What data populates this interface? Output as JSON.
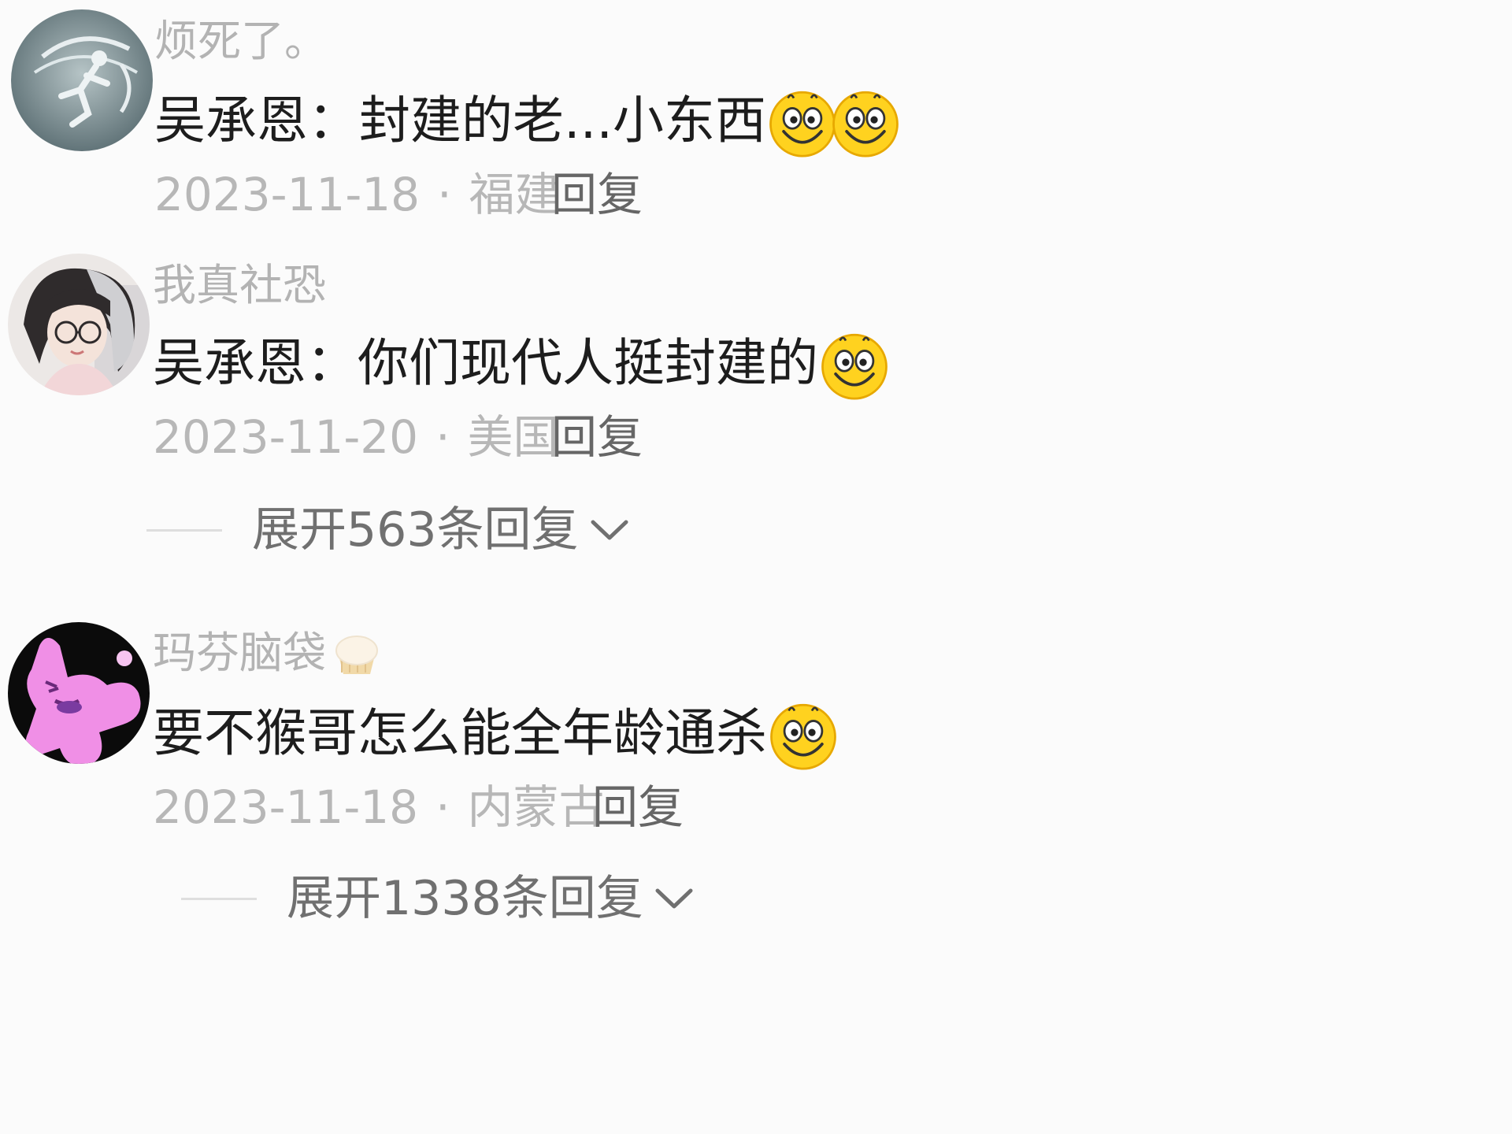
{
  "comments": [
    {
      "username": "烦死了。",
      "content": "吴承恩：封建的老...小东西",
      "emoji_count": 2,
      "date": "2023-11-18",
      "location": "福建",
      "reply_label": "回复"
    },
    {
      "username": "我真社恐",
      "content": "吴承恩：你们现代人挺封建的",
      "emoji_count": 1,
      "date": "2023-11-20",
      "location": "美国",
      "reply_label": "回复",
      "expand_label": "展开563条回复"
    },
    {
      "username": "玛芬脑袋",
      "username_badge_icon": "muffin-icon",
      "content": "要不猴哥怎么能全年龄通杀",
      "emoji_count": 1,
      "date": "2023-11-18",
      "location": "内蒙古",
      "reply_label": "回复",
      "expand_label": "展开1338条回复"
    }
  ],
  "separator": "·",
  "icons": {
    "emoji": "smiling-face-icon",
    "expand": "chevron-down-icon"
  },
  "colors": {
    "background": "#fbfbfb",
    "username": "#b3b3b3",
    "content": "#1d1d1d",
    "meta": "#b7b7b7",
    "reply": "#666666",
    "emoji": "#ffd21f"
  }
}
